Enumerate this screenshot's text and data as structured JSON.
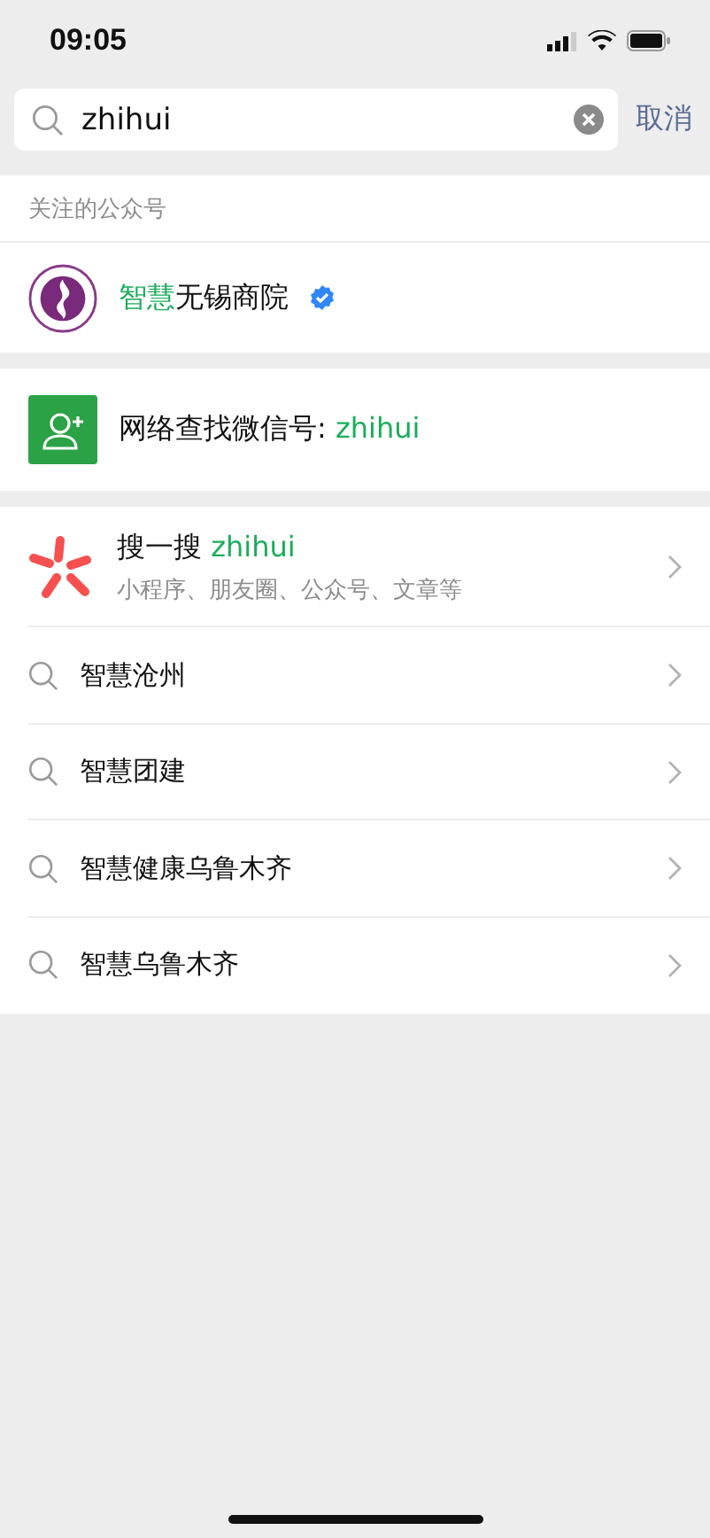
{
  "status_bar": {
    "time": "09:05"
  },
  "search": {
    "value": "zhihui",
    "cancel": "取消"
  },
  "followed_accounts": {
    "header": "关注的公众号",
    "items": [
      {
        "name_parts": [
          {
            "text": "智慧",
            "highlight": true
          },
          {
            "text": "无锡商院",
            "highlight": false
          }
        ],
        "verified": true
      }
    ]
  },
  "network_lookup": {
    "label": "网络查找微信号: ",
    "query": "zhihui"
  },
  "search_one": {
    "label": "搜一搜",
    "query": "zhihui",
    "subtitle": "小程序、朋友圈、公众号、文章等"
  },
  "suggestions": [
    {
      "text": "智慧沧州"
    },
    {
      "text": "智慧团建"
    },
    {
      "text": "智慧健康乌鲁木齐"
    },
    {
      "text": "智慧乌鲁木齐"
    }
  ]
}
